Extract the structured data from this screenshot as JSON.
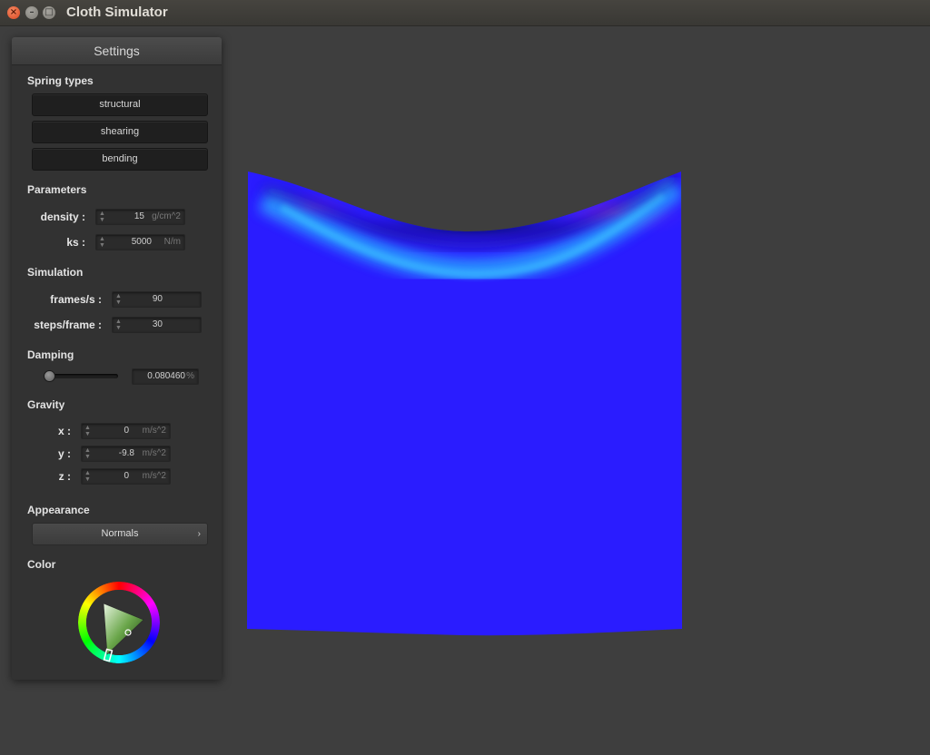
{
  "window": {
    "title": "Cloth Simulator"
  },
  "panel": {
    "title": "Settings",
    "spring_types": {
      "heading": "Spring types",
      "buttons": [
        "structural",
        "shearing",
        "bending"
      ]
    },
    "parameters": {
      "heading": "Parameters",
      "density": {
        "label": "density :",
        "value": "15",
        "unit": "g/cm^2"
      },
      "ks": {
        "label": "ks :",
        "value": "5000",
        "unit": "N/m"
      }
    },
    "simulation": {
      "heading": "Simulation",
      "fps": {
        "label": "frames/s :",
        "value": "90"
      },
      "steps": {
        "label": "steps/frame :",
        "value": "30"
      }
    },
    "damping": {
      "heading": "Damping",
      "value": "0.080460",
      "unit": "%",
      "slider_fraction": 0.04
    },
    "gravity": {
      "heading": "Gravity",
      "x": {
        "label": "x :",
        "value": "0",
        "unit": "m/s^2"
      },
      "y": {
        "label": "y :",
        "value": "-9.8",
        "unit": "m/s^2"
      },
      "z": {
        "label": "z :",
        "value": "0",
        "unit": "m/s^2"
      }
    },
    "appearance": {
      "heading": "Appearance",
      "selected": "Normals"
    },
    "color": {
      "heading": "Color"
    }
  },
  "colors": {
    "cloth": "#2a1cff",
    "viewport_bg": "#3e3e3e",
    "panel_bg": "#323232"
  },
  "icons": {
    "close": "close-icon",
    "minimize": "minimize-icon",
    "maximize": "maximize-icon",
    "spinner": "spinner-arrows-icon",
    "chevron": "chevron-right-icon"
  }
}
